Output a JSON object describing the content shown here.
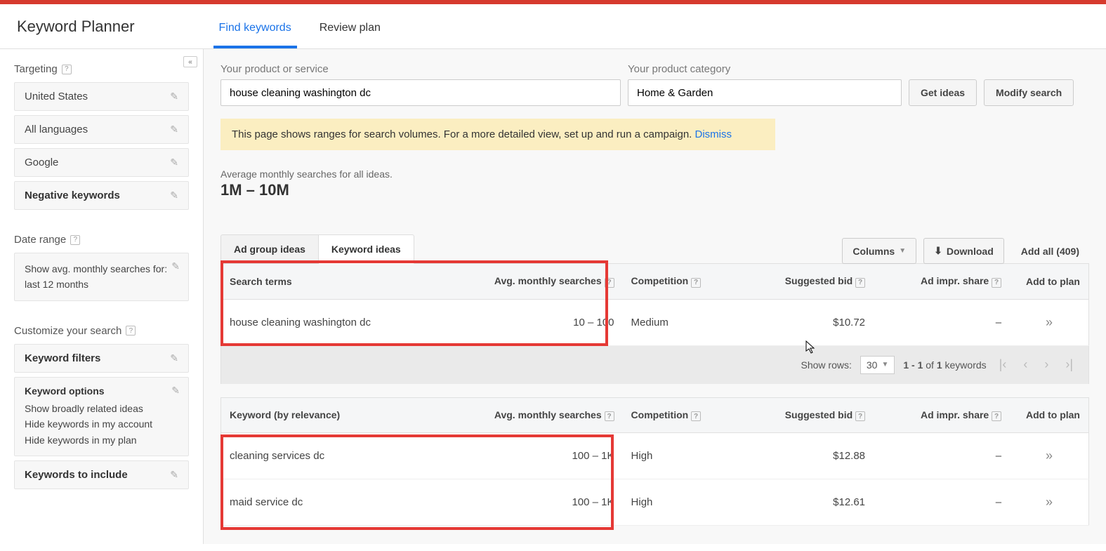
{
  "app_title": "Keyword Planner",
  "header_tabs": [
    {
      "label": "Find keywords",
      "active": true
    },
    {
      "label": "Review plan",
      "active": false
    }
  ],
  "sidebar": {
    "targeting": {
      "label": "Targeting",
      "items": [
        {
          "label": "United States"
        },
        {
          "label": "All languages"
        },
        {
          "label": "Google"
        },
        {
          "label": "Negative keywords",
          "bold": true
        }
      ]
    },
    "date_range": {
      "label": "Date range",
      "text": "Show avg. monthly searches for: last 12 months"
    },
    "customize": {
      "label": "Customize your search",
      "keyword_filters": "Keyword filters",
      "keyword_options": {
        "title": "Keyword options",
        "lines": [
          "Show broadly related ideas",
          "Hide keywords in my account",
          "Hide keywords in my plan"
        ]
      },
      "keywords_to_include": "Keywords to include"
    }
  },
  "inputs": {
    "product_label": "Your product or service",
    "product_value": "house cleaning washington dc",
    "category_label": "Your product category",
    "category_value": "Home & Garden",
    "get_ideas": "Get ideas",
    "modify_search": "Modify search"
  },
  "notice": {
    "text": "This page shows ranges for search volumes. For a more detailed view, set up and run a campaign. ",
    "link": "Dismiss"
  },
  "summary": {
    "label": "Average monthly searches for all ideas.",
    "value": "1M – 10M"
  },
  "inner_tabs": [
    {
      "label": "Ad group ideas",
      "active": false
    },
    {
      "label": "Keyword ideas",
      "active": true
    }
  ],
  "toolbar": {
    "columns": "Columns",
    "download": "Download",
    "add_all": "Add all (409)"
  },
  "table1": {
    "headers": {
      "search_terms": "Search terms",
      "avg_searches": "Avg. monthly searches",
      "competition": "Competition",
      "suggested_bid": "Suggested bid",
      "ad_impr": "Ad impr. share",
      "add_plan": "Add to plan"
    },
    "rows": [
      {
        "term": "house cleaning washington dc",
        "searches": "10 – 100",
        "competition": "Medium",
        "bid": "$10.72",
        "impr": "–"
      }
    ]
  },
  "pager": {
    "show_rows": "Show rows:",
    "rows_value": "30",
    "range": "1 - 1 of 1 keywords"
  },
  "table2": {
    "headers": {
      "keyword": "Keyword (by relevance)",
      "avg_searches": "Avg. monthly searches",
      "competition": "Competition",
      "suggested_bid": "Suggested bid",
      "ad_impr": "Ad impr. share",
      "add_plan": "Add to plan"
    },
    "rows": [
      {
        "term": "cleaning services dc",
        "searches": "100 – 1K",
        "competition": "High",
        "bid": "$12.88",
        "impr": "–"
      },
      {
        "term": "maid service dc",
        "searches": "100 – 1K",
        "competition": "High",
        "bid": "$12.61",
        "impr": "–"
      }
    ]
  }
}
